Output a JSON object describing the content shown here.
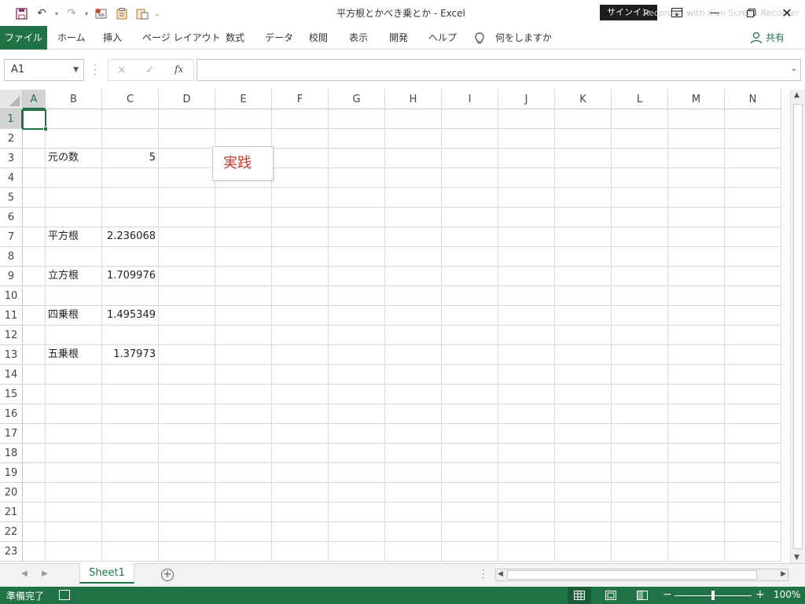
{
  "window": {
    "title": "平方根とかべき乗とか  -  Excel",
    "signin_label": "サインイン",
    "watermark": "Recorded with iFun Screen Recorder"
  },
  "ribbon": {
    "tabs": [
      "ファイル",
      "ホーム",
      "挿入",
      "ページ レイアウト",
      "数式",
      "データ",
      "校閲",
      "表示",
      "開発",
      "ヘルプ"
    ],
    "tell_me": "何をしますか",
    "share": "共有"
  },
  "formula_bar": {
    "name_box": "A1",
    "fx_label": "fx",
    "cancel_icon": "×",
    "enter_icon": "✓",
    "value": ""
  },
  "sheet": {
    "columns": [
      "A",
      "B",
      "C",
      "D",
      "E",
      "F",
      "G",
      "H",
      "I",
      "J",
      "K",
      "L",
      "M",
      "N"
    ],
    "rows": [
      "1",
      "2",
      "3",
      "4",
      "5",
      "6",
      "7",
      "8",
      "9",
      "10",
      "11",
      "12",
      "13",
      "14",
      "15",
      "16",
      "17",
      "18",
      "19",
      "20",
      "21",
      "22",
      "23"
    ],
    "selected_cell": "A1",
    "cells": {
      "B3": "元の数",
      "C3": "5",
      "B7": "平方根",
      "C7": "2.236068",
      "B9": "立方根",
      "C9": "1.709976",
      "B11": "四乗根",
      "C11": "1.495349",
      "B13": "五乗根",
      "C13": "1.37973"
    },
    "shape_button_label": "実践"
  },
  "sheet_tabs": {
    "tabs": [
      "Sheet1"
    ],
    "active": "Sheet1"
  },
  "status_bar": {
    "status_text": "準備完了",
    "zoom": "100%"
  },
  "colors": {
    "accent": "#217346",
    "shape_text": "#c0392b"
  }
}
